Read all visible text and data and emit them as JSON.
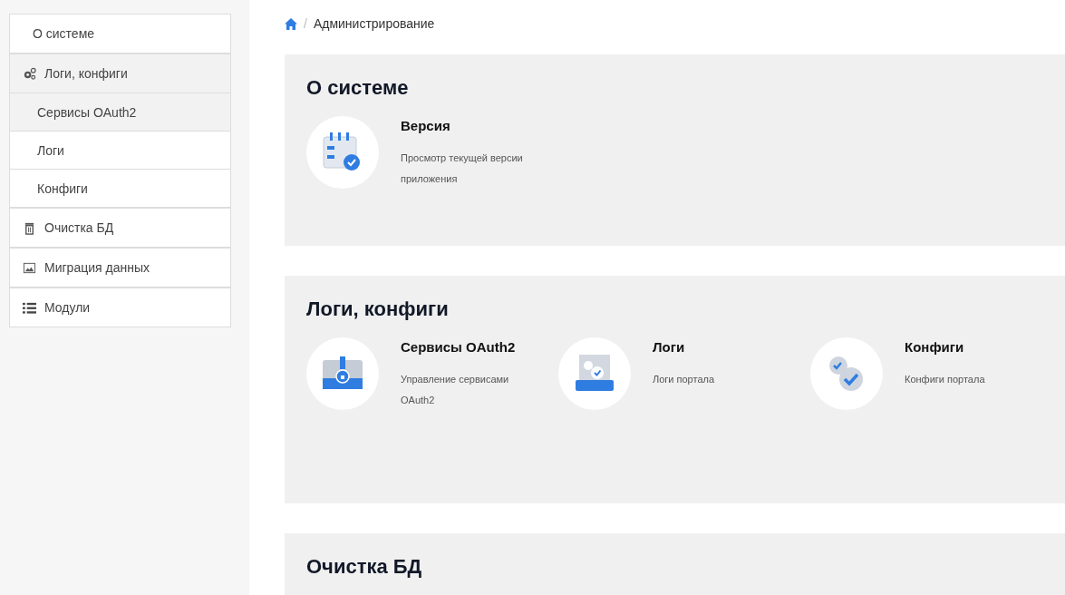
{
  "sidebar": {
    "items": [
      {
        "label": "О системе",
        "selected": false
      },
      {
        "label": "Логи, конфиги",
        "expanded": true,
        "children": [
          {
            "label": "Сервисы OAuth2",
            "selected": true
          },
          {
            "label": "Логи",
            "selected": false
          },
          {
            "label": "Конфиги",
            "selected": false
          }
        ]
      },
      {
        "label": "Очистка БД",
        "selected": false
      },
      {
        "label": "Миграция данных",
        "selected": false
      },
      {
        "label": "Модули",
        "selected": false
      }
    ]
  },
  "breadcrumb": {
    "separator": "/",
    "current": "Администрирование"
  },
  "sections": [
    {
      "title": "О системе",
      "cards": [
        {
          "title": "Версия",
          "description": "Просмотр текущей версии приложения"
        }
      ]
    },
    {
      "title": "Логи, конфиги",
      "cards": [
        {
          "title": "Сервисы OAuth2",
          "description": "Управление сервисами OAuth2"
        },
        {
          "title": "Логи",
          "description": "Логи портала"
        },
        {
          "title": "Конфиги",
          "description": "Конфиги портала"
        }
      ]
    },
    {
      "title": "Очистка БД"
    }
  ]
}
